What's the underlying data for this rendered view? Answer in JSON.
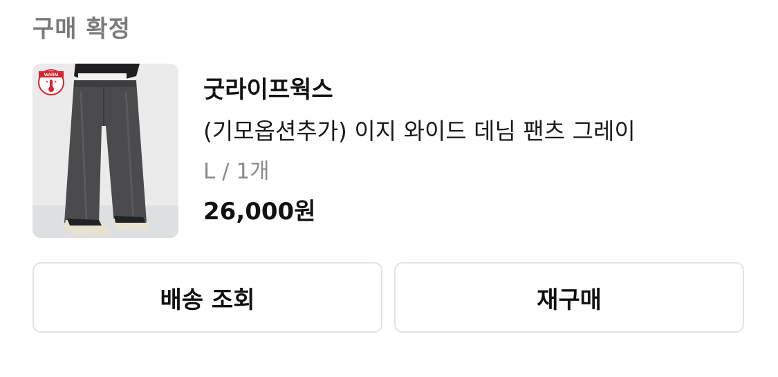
{
  "order": {
    "status_title": "구매 확정"
  },
  "product": {
    "badge_text": "WARM",
    "brand": "굿라이프웍스",
    "name": "(기모옵션추가) 이지 와이드 데님 팬츠 그레이",
    "option": "L / 1개",
    "price": "26,000원"
  },
  "actions": {
    "track_delivery_label": "배송 조회",
    "repurchase_label": "재구매"
  },
  "colors": {
    "status_title": "#7a7a7a",
    "option_text": "#8a8a8a",
    "button_border": "#e2e2e2",
    "badge_red": "#d9232d"
  },
  "icons": {
    "badge": "warm-thermometer-icon"
  }
}
